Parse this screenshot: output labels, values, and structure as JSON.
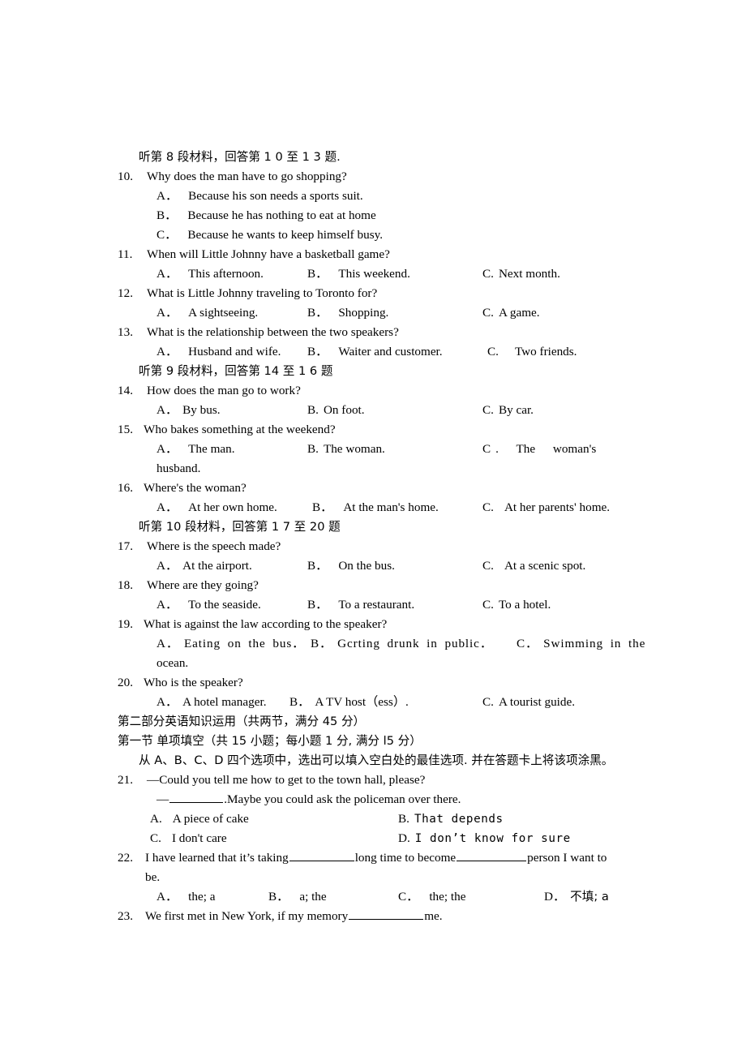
{
  "document": {
    "type": "exam-paper",
    "language_mix": "chinese-english",
    "page_background": "#ffffff",
    "text_color": "#000000"
  },
  "listening": {
    "heading_8": "听第 8 段材料，回答第 1 0 至 1 3 题.",
    "heading_9": "听第 9 段材料，回答第 14 至 1 6 题",
    "heading_10": "听第 10 段材料，回答第 1 7 至 20 题",
    "questions": [
      {
        "number": "10.",
        "stem": "Why does the man have to go    shopping?",
        "layout": "stacked",
        "options": [
          {
            "letter": "A．",
            "text": "Because his son needs a    sports    suit."
          },
          {
            "letter": "B．",
            "text": "Because he has nothing to eat    at home"
          },
          {
            "letter": "C．",
            "text": "Because he wants to keep himself busy."
          }
        ]
      },
      {
        "number": "11.",
        "stem": "When will Little Johnny have a basketball game?",
        "layout": "three-column",
        "options": [
          {
            "letter": "A．",
            "text": "This afternoon."
          },
          {
            "letter": "B．",
            "text": "This weekend."
          },
          {
            "letter": "C.",
            "text": "Next month."
          }
        ]
      },
      {
        "number": "12.",
        "stem": "What is Little Johnny traveling to Toronto for?",
        "layout": "three-column",
        "options": [
          {
            "letter": "A．",
            "text": "A sightseeing."
          },
          {
            "letter": "B．",
            "text": "Shopping."
          },
          {
            "letter": "C.",
            "text": "A game."
          }
        ]
      },
      {
        "number": "13.",
        "stem": "What is the relationship between the two speakers?",
        "layout": "three-column",
        "options": [
          {
            "letter": "A．",
            "text": "Husband and wife."
          },
          {
            "letter": "B．",
            "text": "Waiter and customer."
          },
          {
            "letter": "C.",
            "text": "Two    friends."
          }
        ]
      },
      {
        "number": "14.",
        "stem": "How does the man go to work?",
        "layout": "three-column",
        "options": [
          {
            "letter": "A．",
            "text": "By bus."
          },
          {
            "letter": "B.",
            "text": "On foot."
          },
          {
            "letter": "C.",
            "text": "By car."
          }
        ]
      },
      {
        "number": "15.",
        "stem": "Who bakes something at the weekend?",
        "layout": "three-column-wrap",
        "options": [
          {
            "letter": "A．",
            "text": "The man."
          },
          {
            "letter": "B.",
            "text": "The woman."
          },
          {
            "letter": "C",
            "text": ".      The      woman's"
          }
        ],
        "continuation": "husband."
      },
      {
        "number": "16.",
        "stem": "Where's the woman?",
        "layout": "three-column",
        "options": [
          {
            "letter": "A．",
            "text": "At her own home."
          },
          {
            "letter": "B．",
            "text": "At the man's home."
          },
          {
            "letter": "C.",
            "text": "At her parents'   home."
          }
        ]
      },
      {
        "number": "17.",
        "stem": "Where is the speech made?",
        "layout": "three-column",
        "options": [
          {
            "letter": "A．",
            "text": "At the airport."
          },
          {
            "letter": "B．",
            "text": "On the bus."
          },
          {
            "letter": "C.",
            "text": "At a scenic spot."
          }
        ]
      },
      {
        "number": "18.",
        "stem": "Where are they going?",
        "layout": "three-column",
        "options": [
          {
            "letter": "A．",
            "text": "To the seaside."
          },
          {
            "letter": "B．",
            "text": "To a restaurant."
          },
          {
            "letter": "C.",
            "text": "To a hotel."
          }
        ]
      },
      {
        "number": "19.",
        "stem": "What is against the law according to the speaker?",
        "layout": "three-column-wrap",
        "options": [
          {
            "letter": "A．",
            "text": "Eating on the bus．"
          },
          {
            "letter": "B．",
            "text": "Gcrting drunk in public．"
          },
          {
            "letter": "C．",
            "text": "Swimming in the"
          }
        ],
        "continuation": "ocean."
      },
      {
        "number": "20.",
        "stem": "Who is the speaker?",
        "layout": "three-column",
        "options": [
          {
            "letter": "A．",
            "text": "A hotel manager."
          },
          {
            "letter": "B．",
            "text": "A TV host（ess）."
          },
          {
            "letter": "C.",
            "text": "A tourist guide."
          }
        ]
      }
    ]
  },
  "part_two": {
    "heading": "第二部分英语知识运用（共两节，满分 45 分）",
    "section_one_heading": "第一节   单项填空（共 15 小题；每小题 1 分, 满分 l5 分）",
    "instruction": "从 A、B、C、D 四个选项中，选出可以填入空白处的最佳选项. 并在答题卡上将该项涂黑。",
    "questions": [
      {
        "number": "21.",
        "stem_line1": "—Could you tell me how to get to the town hall, please?",
        "stem_line2_pre": "—",
        "stem_line2_post": ".Maybe you could ask the policeman over there.",
        "layout": "two-column",
        "options": [
          {
            "letter": "A.",
            "text": "A piece of cake",
            "font": "serif"
          },
          {
            "letter": "B.",
            "text": "That depends",
            "font": "mono"
          },
          {
            "letter": "C.",
            "text": "I don't care",
            "font": "serif"
          },
          {
            "letter": "D.",
            "text": "I don’t know for sure",
            "font": "mono"
          }
        ]
      },
      {
        "number": "22.",
        "stem_a": "I have learned that it’s taking",
        "stem_b": "long time to become",
        "stem_c": "person I want to",
        "stem_d": "be.",
        "layout": "four-column",
        "options": [
          {
            "letter": "A．",
            "text": "the; a"
          },
          {
            "letter": "B．",
            "text": "a; the"
          },
          {
            "letter": "C．",
            "text": "the; the"
          },
          {
            "letter": "D．",
            "text": "不填; a"
          }
        ]
      },
      {
        "number": "23.",
        "stem_a": "We first met in New York, if my memory",
        "stem_b": "me."
      }
    ]
  }
}
